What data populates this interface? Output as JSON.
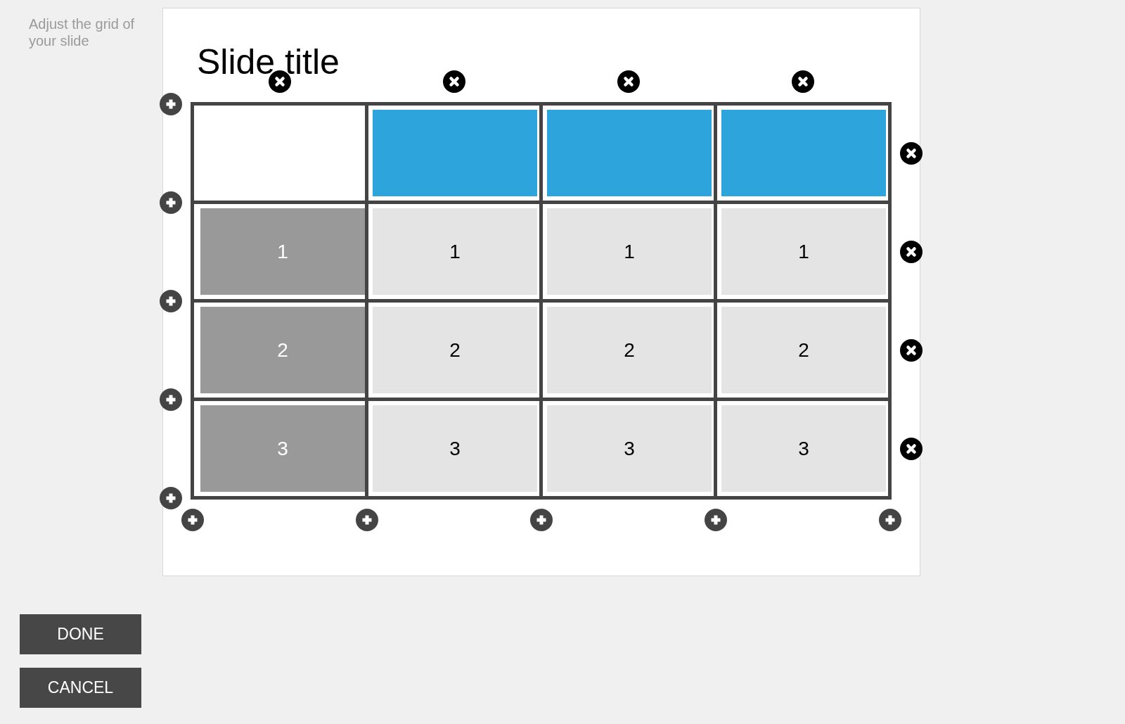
{
  "instruction": "Adjust the grid of your slide",
  "slide": {
    "title": "Slide title",
    "grid": {
      "rows": [
        {
          "cells": [
            {
              "kind": "blank"
            },
            {
              "kind": "header"
            },
            {
              "kind": "header"
            },
            {
              "kind": "header"
            }
          ]
        },
        {
          "cells": [
            {
              "kind": "label",
              "text": "1"
            },
            {
              "kind": "body",
              "text": "1"
            },
            {
              "kind": "body",
              "text": "1"
            },
            {
              "kind": "body",
              "text": "1"
            }
          ]
        },
        {
          "cells": [
            {
              "kind": "label",
              "text": "2"
            },
            {
              "kind": "body",
              "text": "2"
            },
            {
              "kind": "body",
              "text": "2"
            },
            {
              "kind": "body",
              "text": "2"
            }
          ]
        },
        {
          "cells": [
            {
              "kind": "label",
              "text": "3"
            },
            {
              "kind": "body",
              "text": "3"
            },
            {
              "kind": "body",
              "text": "3"
            },
            {
              "kind": "body",
              "text": "3"
            }
          ]
        }
      ]
    }
  },
  "buttons": [
    {
      "label": "DONE"
    },
    {
      "label": "CANCEL"
    }
  ]
}
